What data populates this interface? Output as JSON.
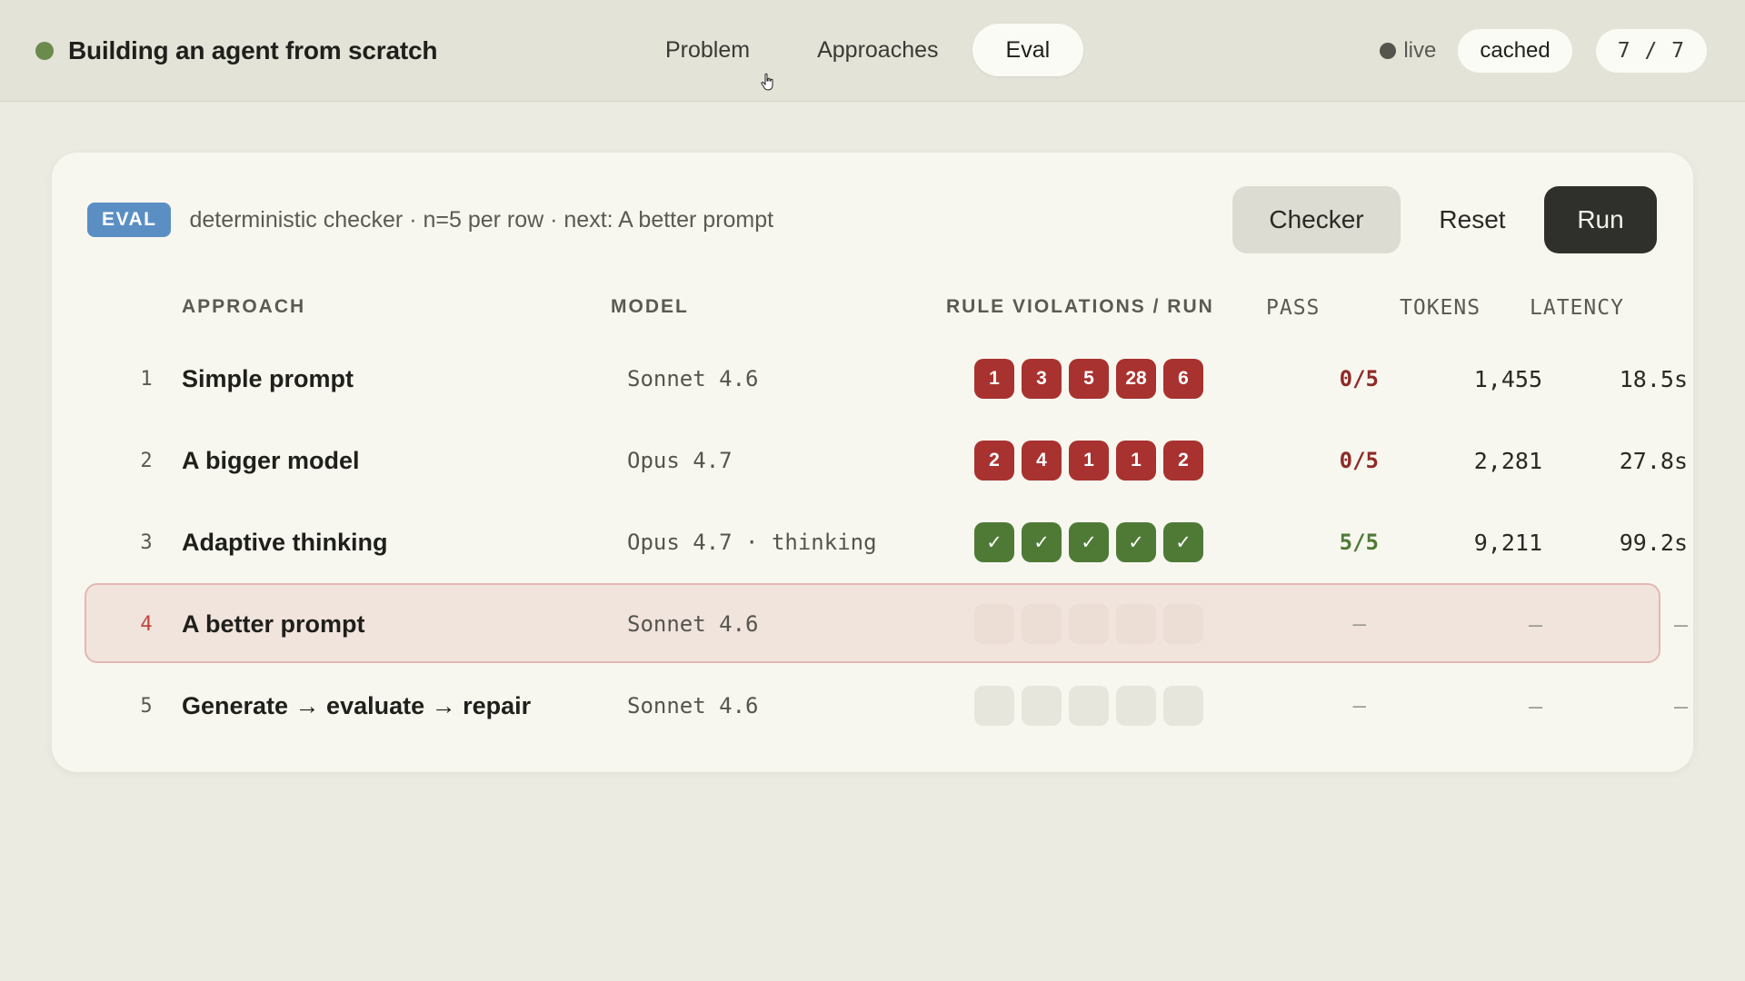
{
  "header": {
    "title": "Building an agent from scratch",
    "status_color": "#6b8a4e",
    "tabs": [
      {
        "label": "Problem",
        "active": false
      },
      {
        "label": "Approaches",
        "active": false
      },
      {
        "label": "Eval",
        "active": true
      }
    ],
    "live_label": "live",
    "cached_label": "cached",
    "page_counter": "7 / 7"
  },
  "eval": {
    "badge": "EVAL",
    "description": "deterministic checker · n=5 per row · next: A better prompt",
    "buttons": {
      "checker": "Checker",
      "reset": "Reset",
      "run": "Run"
    },
    "columns": {
      "approach": "APPROACH",
      "model": "MODEL",
      "violations": "RULE VIOLATIONS / RUN",
      "pass": "PASS",
      "tokens": "TOKENS",
      "latency": "LATENCY"
    },
    "rows": [
      {
        "num": "1",
        "approach": "Simple prompt",
        "model": "Sonnet 4.6",
        "runs": [
          "1",
          "3",
          "5",
          "28",
          "6"
        ],
        "status": "fail",
        "pass": "0/5",
        "tokens": "1,455",
        "latency": "18.5s"
      },
      {
        "num": "2",
        "approach": "A bigger model",
        "model": "Opus 4.7",
        "runs": [
          "2",
          "4",
          "1",
          "1",
          "2"
        ],
        "status": "fail",
        "pass": "0/5",
        "tokens": "2,281",
        "latency": "27.8s"
      },
      {
        "num": "3",
        "approach": "Adaptive thinking",
        "model": "Opus 4.7 · thinking",
        "runs": [
          "✓",
          "✓",
          "✓",
          "✓",
          "✓"
        ],
        "status": "pass",
        "pass": "5/5",
        "tokens": "9,211",
        "latency": "99.2s"
      },
      {
        "num": "4",
        "approach": "A better prompt",
        "model": "Sonnet 4.6",
        "runs": [
          "",
          "",
          "",
          "",
          ""
        ],
        "status": "pending",
        "pass": "–",
        "tokens": "–",
        "latency": "–"
      },
      {
        "num": "5",
        "approach": "Generate → evaluate → repair",
        "model": "Sonnet 4.6",
        "runs": [
          "",
          "",
          "",
          "",
          ""
        ],
        "status": "pending",
        "pass": "–",
        "tokens": "–",
        "latency": "–"
      }
    ]
  },
  "colors": {
    "fail": "#a8322f",
    "pass": "#4f7a36",
    "accent_badge": "#5b8fc4",
    "highlight_row": "#f1e4dd"
  }
}
